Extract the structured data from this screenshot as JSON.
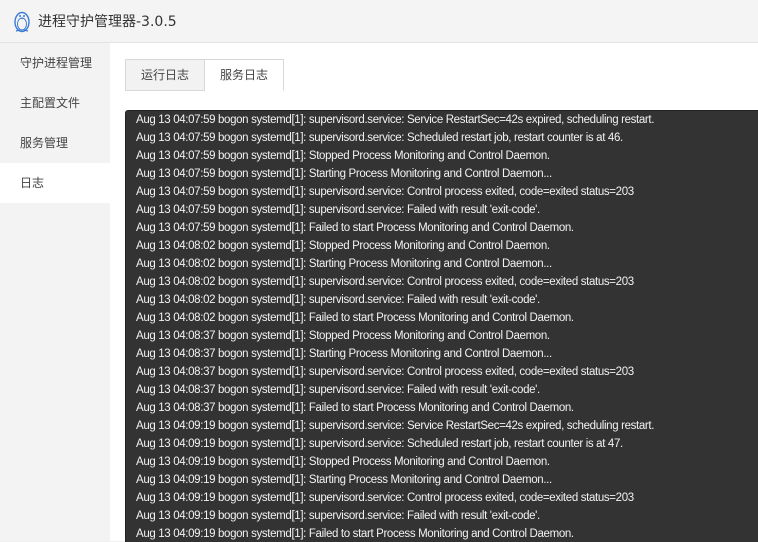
{
  "window": {
    "title": "进程守护管理器-3.0.5",
    "icon": "penguin-icon"
  },
  "sidebar": {
    "items": [
      {
        "label": "守护进程管理",
        "active": false
      },
      {
        "label": "主配置文件",
        "active": false
      },
      {
        "label": "服务管理",
        "active": false
      },
      {
        "label": "日志",
        "active": true
      }
    ]
  },
  "tabs": [
    {
      "label": "运行日志",
      "active": false
    },
    {
      "label": "服务日志",
      "active": true
    }
  ],
  "log": {
    "lines": [
      "Aug 13 04:07:59 bogon systemd[1]: supervisord.service: Service RestartSec=42s expired, scheduling restart.",
      "Aug 13 04:07:59 bogon systemd[1]: supervisord.service: Scheduled restart job, restart counter is at 46.",
      "Aug 13 04:07:59 bogon systemd[1]: Stopped Process Monitoring and Control Daemon.",
      "Aug 13 04:07:59 bogon systemd[1]: Starting Process Monitoring and Control Daemon...",
      "Aug 13 04:07:59 bogon systemd[1]: supervisord.service: Control process exited, code=exited status=203",
      "Aug 13 04:07:59 bogon systemd[1]: supervisord.service: Failed with result 'exit-code'.",
      "Aug 13 04:07:59 bogon systemd[1]: Failed to start Process Monitoring and Control Daemon.",
      "Aug 13 04:08:02 bogon systemd[1]: Stopped Process Monitoring and Control Daemon.",
      "Aug 13 04:08:02 bogon systemd[1]: Starting Process Monitoring and Control Daemon...",
      "Aug 13 04:08:02 bogon systemd[1]: supervisord.service: Control process exited, code=exited status=203",
      "Aug 13 04:08:02 bogon systemd[1]: supervisord.service: Failed with result 'exit-code'.",
      "Aug 13 04:08:02 bogon systemd[1]: Failed to start Process Monitoring and Control Daemon.",
      "Aug 13 04:08:37 bogon systemd[1]: Stopped Process Monitoring and Control Daemon.",
      "Aug 13 04:08:37 bogon systemd[1]: Starting Process Monitoring and Control Daemon...",
      "Aug 13 04:08:37 bogon systemd[1]: supervisord.service: Control process exited, code=exited status=203",
      "Aug 13 04:08:37 bogon systemd[1]: supervisord.service: Failed with result 'exit-code'.",
      "Aug 13 04:08:37 bogon systemd[1]: Failed to start Process Monitoring and Control Daemon.",
      "Aug 13 04:09:19 bogon systemd[1]: supervisord.service: Service RestartSec=42s expired, scheduling restart.",
      "Aug 13 04:09:19 bogon systemd[1]: supervisord.service: Scheduled restart job, restart counter is at 47.",
      "Aug 13 04:09:19 bogon systemd[1]: Stopped Process Monitoring and Control Daemon.",
      "Aug 13 04:09:19 bogon systemd[1]: Starting Process Monitoring and Control Daemon...",
      "Aug 13 04:09:19 bogon systemd[1]: supervisord.service: Control process exited, code=exited status=203",
      "Aug 13 04:09:19 bogon systemd[1]: supervisord.service: Failed with result 'exit-code'.",
      "Aug 13 04:09:19 bogon systemd[1]: Failed to start Process Monitoring and Control Daemon."
    ]
  },
  "colors": {
    "log_background": "#333333",
    "log_text": "#f2f2f2",
    "sidebar_background": "#f3f3f3",
    "active_background": "#ffffff"
  }
}
